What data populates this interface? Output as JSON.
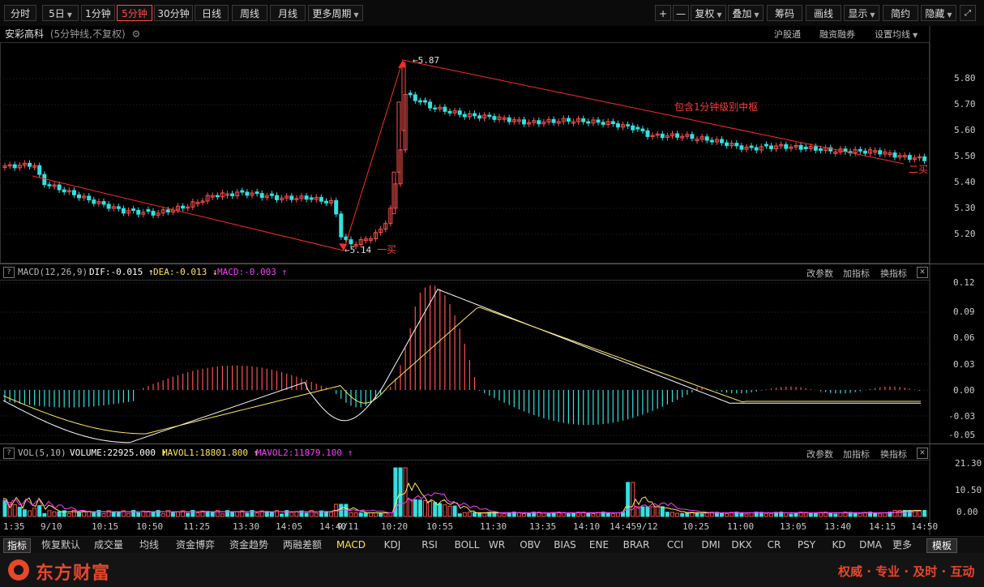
{
  "toolbar": {
    "periods": [
      "分时",
      "5日",
      "1分钟",
      "5分钟",
      "30分钟",
      "日线",
      "周线",
      "月线",
      "更多周期"
    ],
    "right_buttons": [
      "+",
      "—",
      "复权",
      "叠加",
      "筹码",
      "画线",
      "显示",
      "简约",
      "隐藏"
    ]
  },
  "stock": {
    "name": "安彩高科",
    "period_note": "(5分钟线,不复权)",
    "links": [
      "沪股通",
      "融资融券",
      "设置均线"
    ]
  },
  "price_axis": [
    "5.80",
    "5.70",
    "5.60",
    "5.50",
    "5.40",
    "5.30",
    "5.20"
  ],
  "annotations": {
    "high": "5.87",
    "low": "5.14",
    "buy1": "一买",
    "buy2": "二买",
    "pivot": "包含1分钟级别中枢"
  },
  "macd": {
    "title": "MACD(12,26,9)",
    "dif": "DIF:-0.015",
    "dea": "DEA:-0.013",
    "macd": "MACD:-0.003",
    "arrows": [
      "↑",
      "↓",
      "↑"
    ],
    "axis": [
      "0.12",
      "0.09",
      "0.06",
      "0.03",
      "0.00",
      "-0.03",
      "-0.05"
    ],
    "links": [
      "改参数",
      "加指标",
      "换指标"
    ]
  },
  "vol": {
    "title": "VOL(5,10)",
    "volume": "VOLUME:22925.000",
    "mavol1": "MAVOL1:18801.800",
    "mavol2": "MAVOL2:11879.100",
    "arrows": [
      "↑",
      "↑",
      "↑"
    ],
    "axis": [
      "21.30",
      "10.50",
      "0.00"
    ],
    "links": [
      "改参数",
      "加指标",
      "换指标"
    ]
  },
  "time_axis": [
    "1:35",
    "9/10",
    "10:15",
    "10:50",
    "11:25",
    "13:30",
    "14:05",
    "14:40",
    "9/11",
    "10:20",
    "10:55",
    "11:30",
    "13:35",
    "14:10",
    "14:459/12",
    "10:25",
    "11:00",
    "13:05",
    "13:40",
    "14:15",
    "14:50"
  ],
  "bottom_tabs": [
    "指标",
    "恢复默认",
    "成交量",
    "均线",
    "资金博弈",
    "资金趋势",
    "两融差额",
    "MACD",
    "KDJ",
    "RSI",
    "BOLL",
    "WR",
    "OBV",
    "BIAS",
    "ENE",
    "BRAR",
    "CCI",
    "DMI",
    "DKX",
    "CR",
    "PSY",
    "KD",
    "DMA",
    "更多",
    "模板"
  ],
  "footer": {
    "brand": "东方财富",
    "slogan": "权威 · 专业 · 及时 · 互动"
  },
  "colors": {
    "up": "#ff5050",
    "down": "#33e0e0",
    "accent": "#ff3b3b",
    "yellow": "#ffe85a",
    "magenta": "#ff3cff"
  }
}
